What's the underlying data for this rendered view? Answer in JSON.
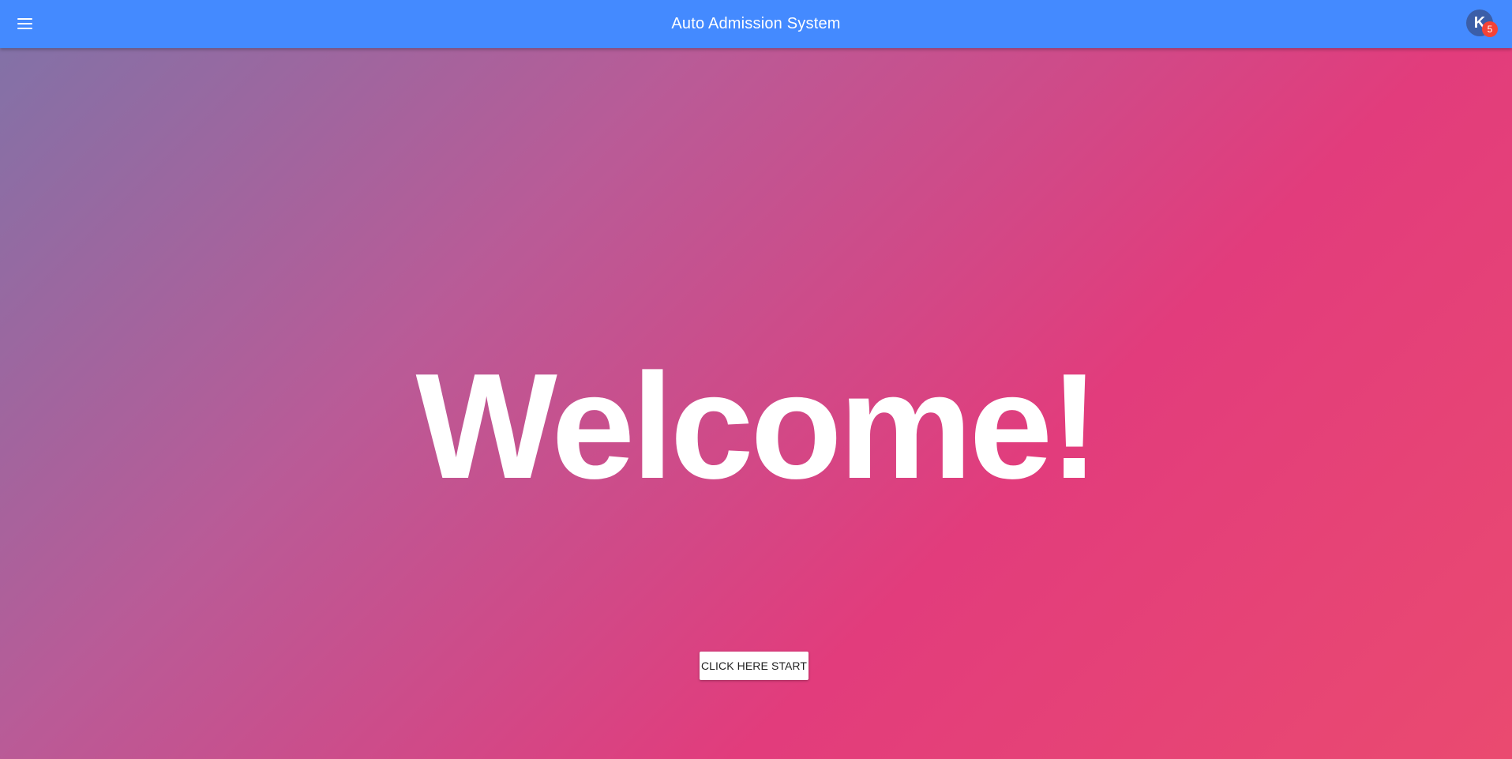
{
  "header": {
    "title": "Auto Admission System",
    "menu_icon": "menu-icon",
    "avatar_initial": "K",
    "notification_count": "5"
  },
  "main": {
    "welcome_text": "Welcome!",
    "start_button_label": "CLICK HERE START"
  },
  "colors": {
    "appbar": "#448aff",
    "badge": "#f44336",
    "gradient_start": "#7f73a8",
    "gradient_end": "#e23c7c"
  }
}
